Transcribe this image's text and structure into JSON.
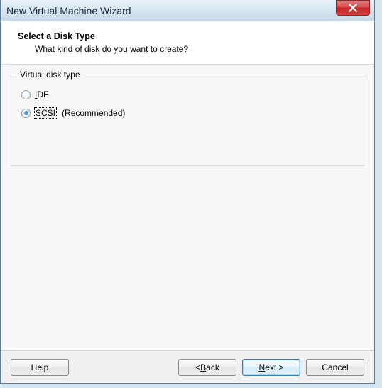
{
  "window": {
    "title": "New Virtual Machine Wizard"
  },
  "header": {
    "title": "Select a Disk Type",
    "subtitle": "What kind of disk do you want to create?"
  },
  "group": {
    "legend": "Virtual disk type",
    "options": [
      {
        "label_pre": "",
        "mnemonic": "I",
        "label_post": "DE",
        "selected": false,
        "suffix": ""
      },
      {
        "label_pre": "",
        "mnemonic": "S",
        "label_post": "CSI",
        "selected": true,
        "suffix": "(Recommended)"
      }
    ]
  },
  "buttons": {
    "help": "Help",
    "back_pre": "< ",
    "back_m": "B",
    "back_post": "ack",
    "next_pre": "",
    "next_m": "N",
    "next_post": "ext >",
    "cancel": "Cancel"
  }
}
